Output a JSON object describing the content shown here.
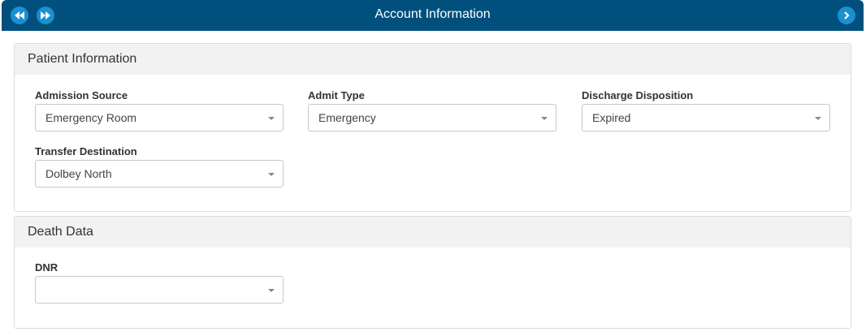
{
  "header": {
    "title": "Account Information",
    "icons": [
      "rewind-icon",
      "fast-forward-icon",
      "chevron-right-icon"
    ]
  },
  "colors": {
    "header_bg": "#004f7c",
    "button_bg": "#1a8fd1",
    "panel_head_bg": "#f2f2f2"
  },
  "patient_info": {
    "title": "Patient Information",
    "admission_source": {
      "label": "Admission Source",
      "value": "Emergency Room"
    },
    "admit_type": {
      "label": "Admit Type",
      "value": "Emergency"
    },
    "discharge_disposition": {
      "label": "Discharge Disposition",
      "value": "Expired"
    },
    "transfer_destination": {
      "label": "Transfer Destination",
      "value": "Dolbey North"
    }
  },
  "death_data": {
    "title": "Death Data",
    "dnr": {
      "label": "DNR",
      "value": ""
    }
  }
}
